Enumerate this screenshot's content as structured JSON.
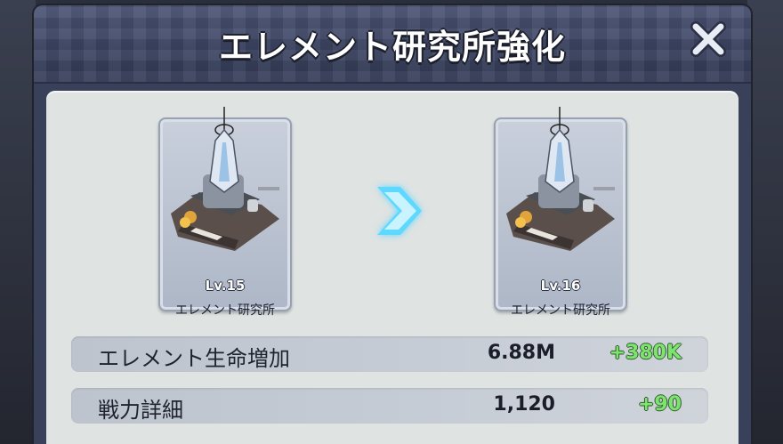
{
  "dialog": {
    "title": "エレメント研究所強化",
    "close_icon": "close-x-icon"
  },
  "upgrade": {
    "current": {
      "level": "Lv.15",
      "name": "エレメント研究所"
    },
    "next": {
      "level": "Lv.16",
      "name": "エレメント研究所"
    },
    "arrow_icon": "chevron-right-icon"
  },
  "stats": [
    {
      "label": "エレメント生命増加",
      "value": "6.88M",
      "delta": "+380K"
    },
    {
      "label": "戦力詳細",
      "value": "1,120",
      "delta": "+90"
    }
  ],
  "colors": {
    "header": "#414a69",
    "panel": "#dfe3e2",
    "delta_green": "#7ee36f",
    "arrow_cyan": "#5fd8ff"
  }
}
